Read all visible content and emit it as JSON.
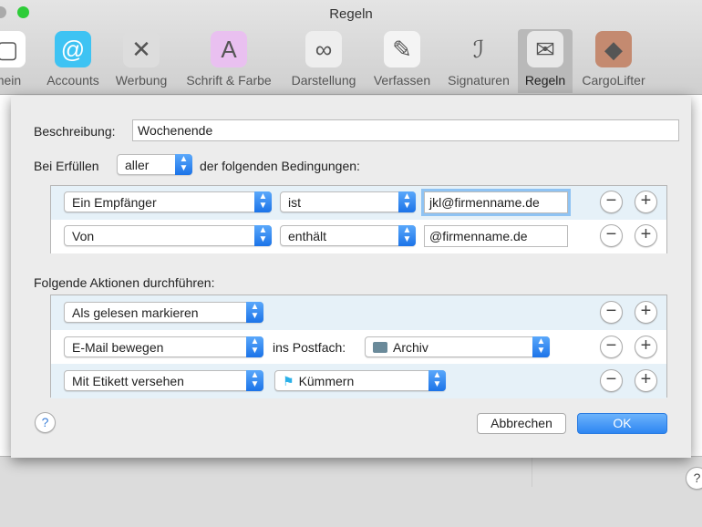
{
  "window": {
    "title": "Regeln"
  },
  "toolbar": {
    "items": [
      {
        "label": "mein",
        "icon": "general-icon"
      },
      {
        "label": "Accounts",
        "icon": "at-icon"
      },
      {
        "label": "Werbung",
        "icon": "junk-bin-icon"
      },
      {
        "label": "Schrift & Farbe",
        "icon": "font-color-icon"
      },
      {
        "label": "Darstellung",
        "icon": "glasses-icon"
      },
      {
        "label": "Verfassen",
        "icon": "pencil-icon"
      },
      {
        "label": "Signaturen",
        "icon": "signature-icon"
      },
      {
        "label": "Regeln",
        "icon": "rules-envelope-icon",
        "selected": true
      },
      {
        "label": "CargoLifter",
        "icon": "cargolifter-icon"
      }
    ]
  },
  "rule": {
    "description_label": "Beschreibung:",
    "description_value": "Wochenende",
    "match_prefix": "Bei Erfüllen",
    "match_value": "aller",
    "match_suffix": "der folgenden Bedingungen:",
    "conditions": [
      {
        "field": "Ein Empfänger",
        "operator": "ist",
        "value": "jkl@firmenname.de"
      },
      {
        "field": "Von",
        "operator": "enthält",
        "value": "@firmenname.de"
      }
    ],
    "actions_label": "Folgende Aktionen durchführen:",
    "actions": [
      {
        "action": "Als gelesen markieren"
      },
      {
        "action": "E-Mail bewegen",
        "target_label": "ins Postfach:",
        "target": "Archiv",
        "target_icon": "archive-box-icon"
      },
      {
        "action": "Mit Etikett versehen",
        "target": "Kümmern",
        "target_icon": "flag-icon"
      }
    ]
  },
  "buttons": {
    "help": "?",
    "cancel": "Abbrechen",
    "ok": "OK",
    "minus": "−",
    "plus": "+"
  },
  "colors": {
    "accent": "#1b73e8",
    "ok": "#3b95f7",
    "selected_row": "#e6f1f8"
  }
}
